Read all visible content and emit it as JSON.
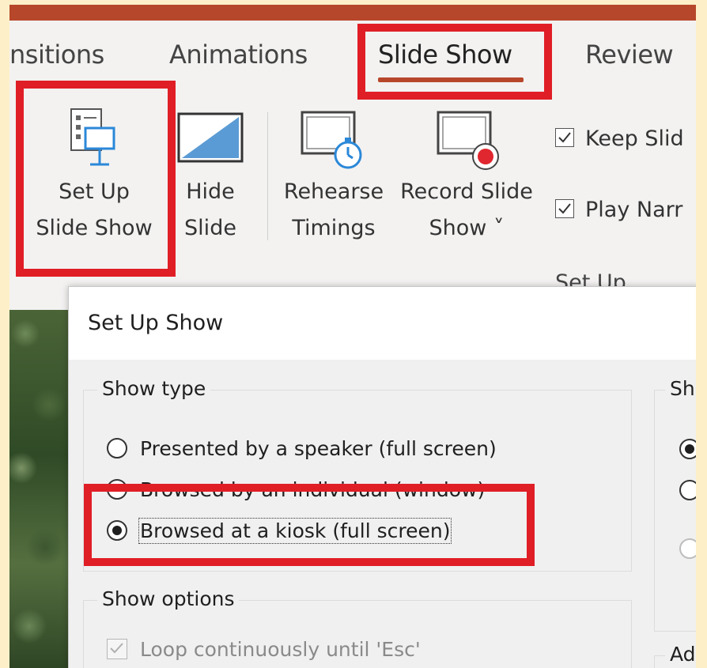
{
  "tabs": [
    {
      "label": "nsitions",
      "active": false
    },
    {
      "label": "Animations",
      "active": false
    },
    {
      "label": "Slide Show",
      "active": true
    },
    {
      "label": "Review",
      "active": false
    }
  ],
  "ribbon": {
    "set_up_slide_show": {
      "line1": "Set Up",
      "line2": "Slide Show",
      "icon": "setup-slideshow-icon"
    },
    "hide_slide": {
      "line1": "Hide",
      "line2": "Slide",
      "icon": "hide-slide-icon"
    },
    "rehearse_timings": {
      "line1": "Rehearse",
      "line2": "Timings",
      "icon": "rehearse-timings-icon"
    },
    "record_slide_show": {
      "line1": "Record Slide",
      "line2": "Show ˅",
      "icon": "record-icon"
    },
    "keep_slides": {
      "label": "Keep Slid",
      "checked": true
    },
    "play_narrations": {
      "label": "Play Narr",
      "checked": true
    },
    "group_label": "Set Up"
  },
  "dialog": {
    "title": "Set Up Show",
    "show_type": {
      "label": "Show type",
      "options": [
        {
          "text": "Presented by a speaker (full screen)",
          "selected": false
        },
        {
          "text": "Browsed by an individual (window)",
          "selected": false
        },
        {
          "text": "Browsed at a kiosk (full screen)",
          "selected": true
        }
      ]
    },
    "show_options": {
      "label": "Show options",
      "loop_label": "Loop continuously until 'Esc'",
      "loop_checked": true,
      "loop_disabled": true
    },
    "right_group_label": "Sh",
    "right_group_label_2": "Ad"
  },
  "colors": {
    "accent": "#b7472a",
    "highlight": "#e01e26",
    "background": "#fdf0c8"
  }
}
